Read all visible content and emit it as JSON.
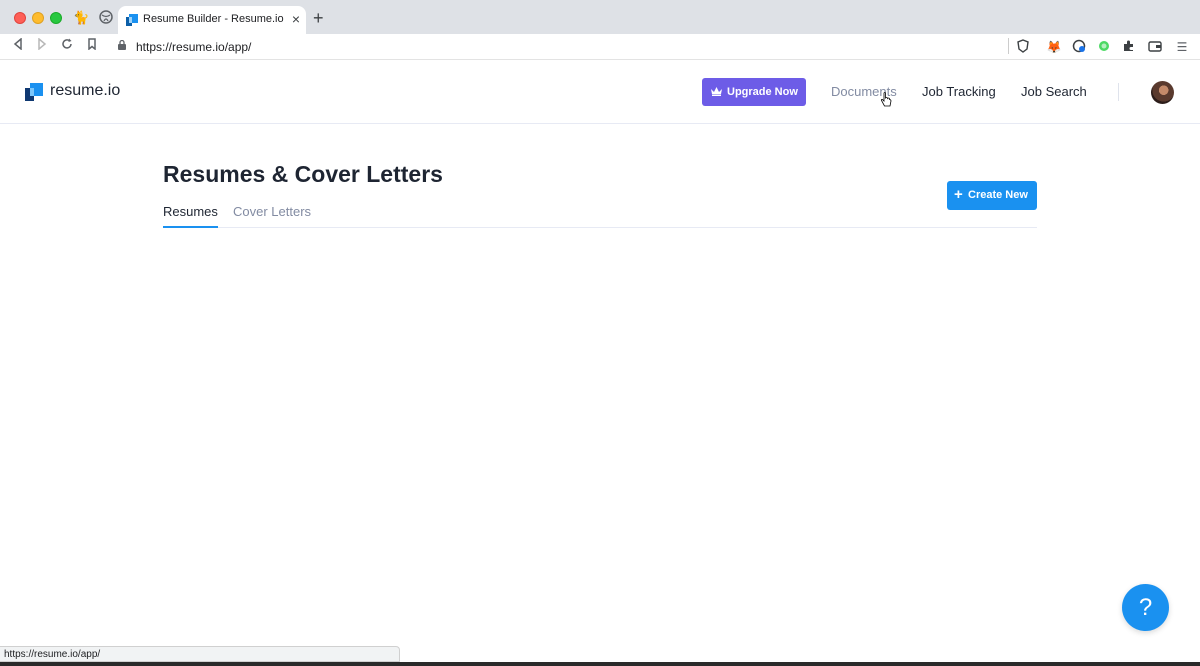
{
  "browser": {
    "tab_title": "Resume Builder - Resume.io",
    "url": "https://resume.io/app/",
    "status_url": "https://resume.io/app/"
  },
  "header": {
    "logo_text": "resume.io",
    "upgrade_label": "Upgrade Now",
    "nav": [
      "Documents",
      "Job Tracking",
      "Job Search"
    ]
  },
  "main": {
    "title": "Resumes & Cover Letters",
    "tabs": [
      "Resumes",
      "Cover Letters"
    ],
    "active_tab": "Resumes",
    "create_label": "Create New"
  },
  "help": {
    "label": "?"
  },
  "colors": {
    "primary": "#1a91f0",
    "upgrade": "#6d5ce7",
    "text": "#1e2532",
    "muted": "#828ba2"
  }
}
